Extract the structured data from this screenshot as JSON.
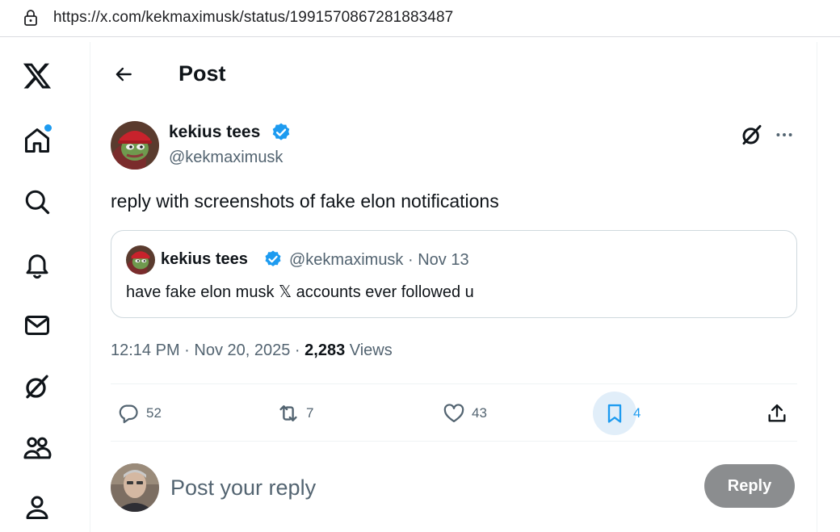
{
  "browser": {
    "url": "https://x.com/kekmaximusk/status/1991570867281883487"
  },
  "nav": {
    "items": [
      {
        "name": "x-logo-icon"
      },
      {
        "name": "home-icon",
        "has_notification_dot": true
      },
      {
        "name": "search-icon"
      },
      {
        "name": "notifications-icon"
      },
      {
        "name": "messages-icon"
      },
      {
        "name": "grok-icon"
      },
      {
        "name": "communities-icon"
      },
      {
        "name": "profile-icon"
      }
    ]
  },
  "header": {
    "title": "Post"
  },
  "post": {
    "author_name": "kekius tees",
    "author_handle": "@kekmaximusk",
    "text": "reply with screenshots of fake elon notifications",
    "quote": {
      "author_name": "kekius tees",
      "author_handle_date": "@kekmaximusk · Nov 13",
      "text": "have fake elon musk 𝕏 accounts ever followed u"
    },
    "time_date": "12:14 PM · Nov 20, 2025 · ",
    "views_count": "2,283",
    "views_label": " Views",
    "actions": {
      "replies": "52",
      "reposts": "7",
      "likes": "43",
      "bookmarks": "4"
    }
  },
  "reply_box": {
    "placeholder": "Post your reply",
    "button_label": "Reply"
  },
  "colors": {
    "accent": "#1d9bf0",
    "text": "#0f1419",
    "secondary_text": "#536471",
    "reply_button_disabled": "#8b8d8f"
  }
}
